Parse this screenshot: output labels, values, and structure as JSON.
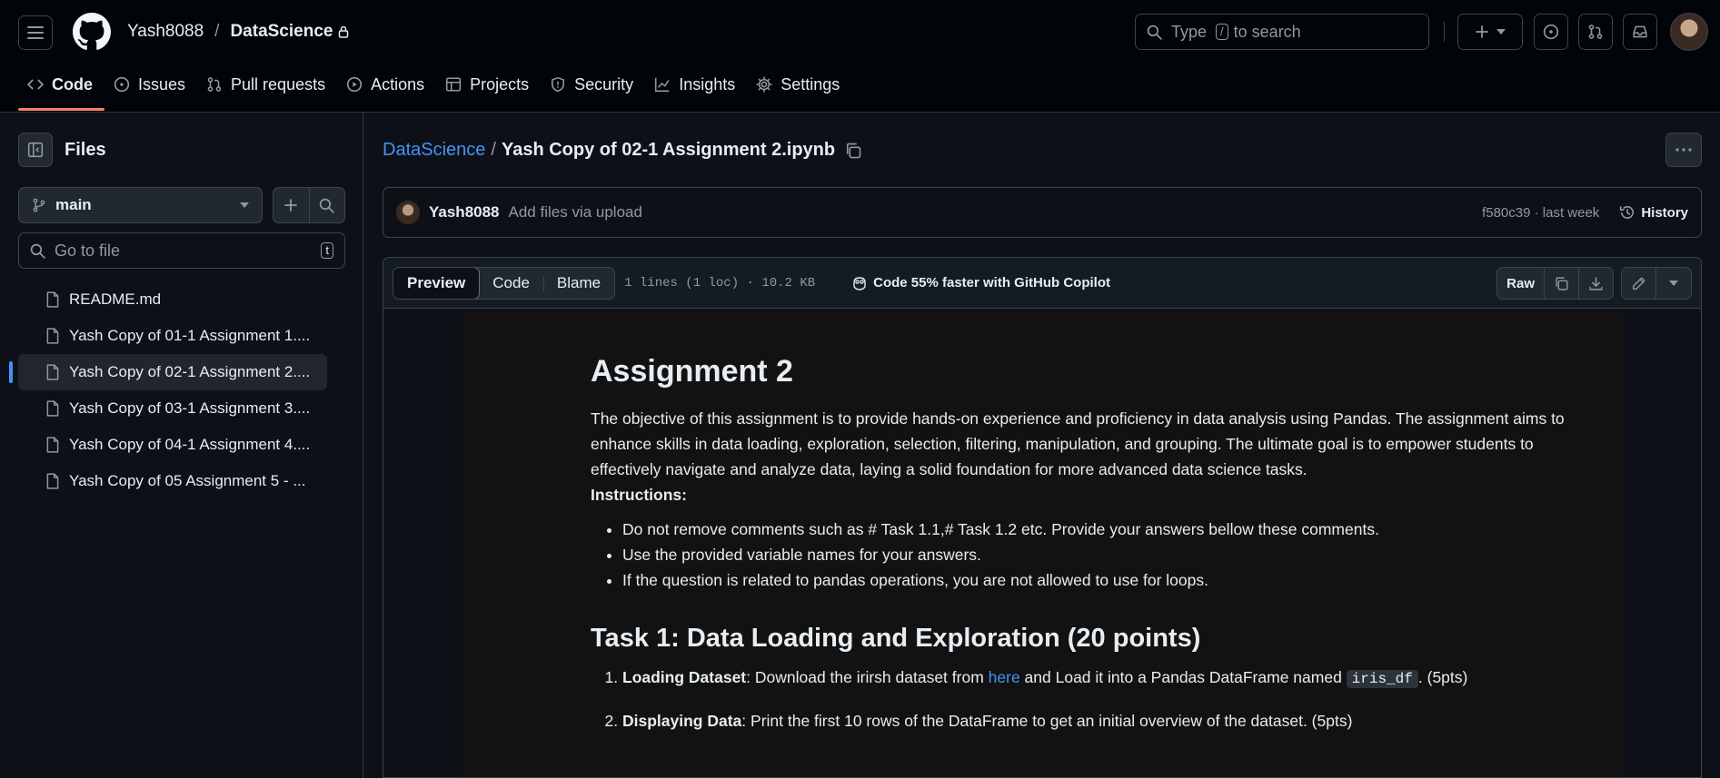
{
  "header": {
    "owner": "Yash8088",
    "separator": "/",
    "repo": "DataScience",
    "search_prefix": "Type",
    "search_key": "/",
    "search_suffix": "to search"
  },
  "nav": {
    "tabs": [
      {
        "label": "Code",
        "icon": "code-icon",
        "active": true
      },
      {
        "label": "Issues",
        "icon": "issue-icon"
      },
      {
        "label": "Pull requests",
        "icon": "pull-request-icon"
      },
      {
        "label": "Actions",
        "icon": "play-icon"
      },
      {
        "label": "Projects",
        "icon": "table-icon"
      },
      {
        "label": "Security",
        "icon": "shield-icon"
      },
      {
        "label": "Insights",
        "icon": "graph-icon"
      },
      {
        "label": "Settings",
        "icon": "gear-icon"
      }
    ]
  },
  "sidebar": {
    "title": "Files",
    "branch": "main",
    "goto_placeholder": "Go to file",
    "goto_key": "t",
    "files": [
      {
        "name": "README.md"
      },
      {
        "name": "Yash Copy of 01-1 Assignment 1...."
      },
      {
        "name": "Yash Copy of 02-1 Assignment 2....",
        "selected": true
      },
      {
        "name": "Yash Copy of 03-1 Assignment 3...."
      },
      {
        "name": "Yash Copy of 04-1 Assignment 4...."
      },
      {
        "name": "Yash Copy of 05 Assignment 5 - ..."
      }
    ]
  },
  "file": {
    "repo_link": "DataScience",
    "sep": "/",
    "name": "Yash Copy of 02-1 Assignment 2.ipynb"
  },
  "commit": {
    "author": "Yash8088",
    "message": "Add files via upload",
    "meta": "f580c39 · last week",
    "history_label": "History"
  },
  "viewer": {
    "tabs": [
      "Preview",
      "Code",
      "Blame"
    ],
    "file_meta": "1 lines (1 loc) · 10.2 KB",
    "copilot_text": "Code 55% faster with GitHub Copilot",
    "raw_label": "Raw"
  },
  "notebook": {
    "title": "Assignment 2",
    "intro": "The objective of this assignment is to provide hands-on experience and proficiency in data analysis using Pandas. The assignment aims to enhance skills in data loading, exploration, selection, filtering, manipulation, and grouping. The ultimate goal is to empower students to effectively navigate and analyze data, laying a solid foundation for more advanced data science tasks.",
    "instructions_label": "Instructions:",
    "bullets": [
      "Do not remove comments such as # Task 1.1,# Task 1.2 etc. Provide your answers bellow these comments.",
      "Use the provided variable names for your answers.",
      "If the question is related to pandas operations, you are not allowed to use for loops."
    ],
    "task1_heading": "Task 1: Data Loading and Exploration (20 points)",
    "task1_items": [
      {
        "bold": "Loading Dataset",
        "before": ": Download the irirsh dataset from ",
        "link": "here",
        "after": " and Load it into a Pandas DataFrame named ",
        "code": "iris_df",
        "end": ". (5pts)"
      },
      {
        "bold": "Displaying Data",
        "before": ": Print the first 10 rows of the DataFrame to get an initial overview of the dataset. (5pts)"
      }
    ]
  },
  "colors": {
    "background": "#0d1117",
    "header_bg": "#010409",
    "accent_underline": "#f78166",
    "link": "#4493f8"
  }
}
